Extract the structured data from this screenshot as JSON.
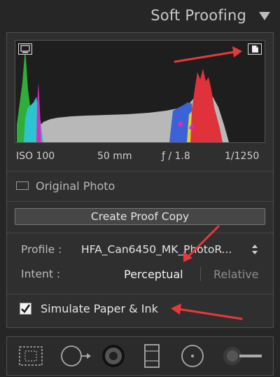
{
  "header": {
    "title": "Soft Proofing",
    "collapse_icon": "triangle-down-icon"
  },
  "histogram": {
    "shadow_clip_icon": "monitor-icon",
    "highlight_clip_icon": "paper-icon"
  },
  "exif": {
    "iso": "ISO 100",
    "focal_length": "50 mm",
    "aperture": "ƒ / 1.8",
    "shutter": "1/1250"
  },
  "original_photo": {
    "label": "Original Photo",
    "checked": false
  },
  "create_proof_copy": {
    "label": "Create Proof Copy"
  },
  "profile": {
    "label": "Profile :",
    "value": "HFA_Can6450_MK_PhotoR..."
  },
  "intent": {
    "label": "Intent :",
    "options": [
      "Perceptual",
      "Relative"
    ],
    "selected": "Perceptual"
  },
  "simulate": {
    "label": "Simulate Paper & Ink",
    "checked": true
  },
  "toolbar": {
    "tools": [
      "crop-overlay-icon",
      "spot-removal-icon",
      "red-eye-icon",
      "graduated-filter-icon",
      "radial-filter-icon",
      "adjustment-brush-icon"
    ]
  },
  "colors": {
    "background": "#262626",
    "panel": "#2f2f2f",
    "annotation_arrow": "#e8383c"
  }
}
